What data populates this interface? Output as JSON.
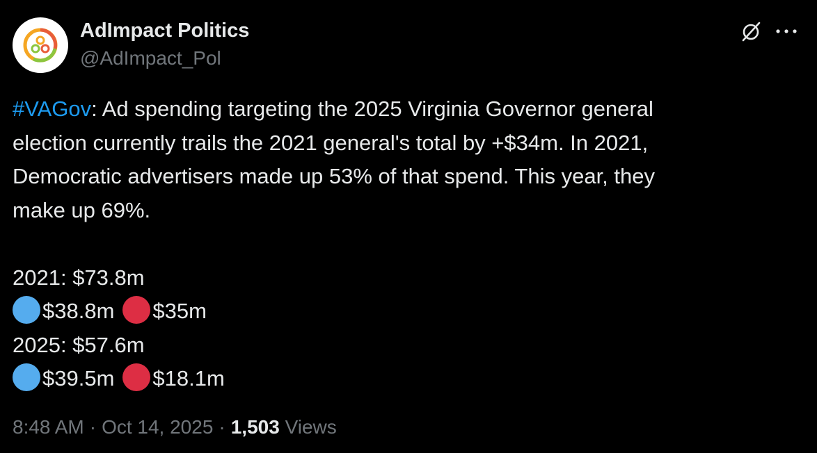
{
  "author": {
    "display_name": "AdImpact Politics",
    "handle": "@AdImpact_Pol",
    "avatar_icon": "adimpact-logo-icon"
  },
  "actions": {
    "grok_icon": "grok-icon",
    "more_label": "···"
  },
  "tweet": {
    "hashtag": "#VAGov",
    "line1_rest": ": Ad spending targeting the 2025 Virginia Governor general",
    "line2": "election currently trails the 2021 general's total by +$34m. In 2021,",
    "line3": "Democratic advertisers made up 53% of that spend. This year, they",
    "line4": "make up 69%.",
    "year2021_total": "2021: $73.8m",
    "year2021_dem": "$38.8m",
    "year2021_rep": "$35m",
    "year2025_total": "2025: $57.6m",
    "year2025_dem": "$39.5m",
    "year2025_rep": "$18.1m"
  },
  "meta": {
    "time": "8:48 AM",
    "separator": "·",
    "date": "Oct 14, 2025",
    "views_count": "1,503",
    "views_label": "Views"
  },
  "colors": {
    "background": "#000000",
    "text": "#e7e9ea",
    "secondary": "#71767b",
    "hashtag": "#1d9bf0",
    "dem_dot": "#55acee",
    "rep_dot": "#dd2e44"
  }
}
